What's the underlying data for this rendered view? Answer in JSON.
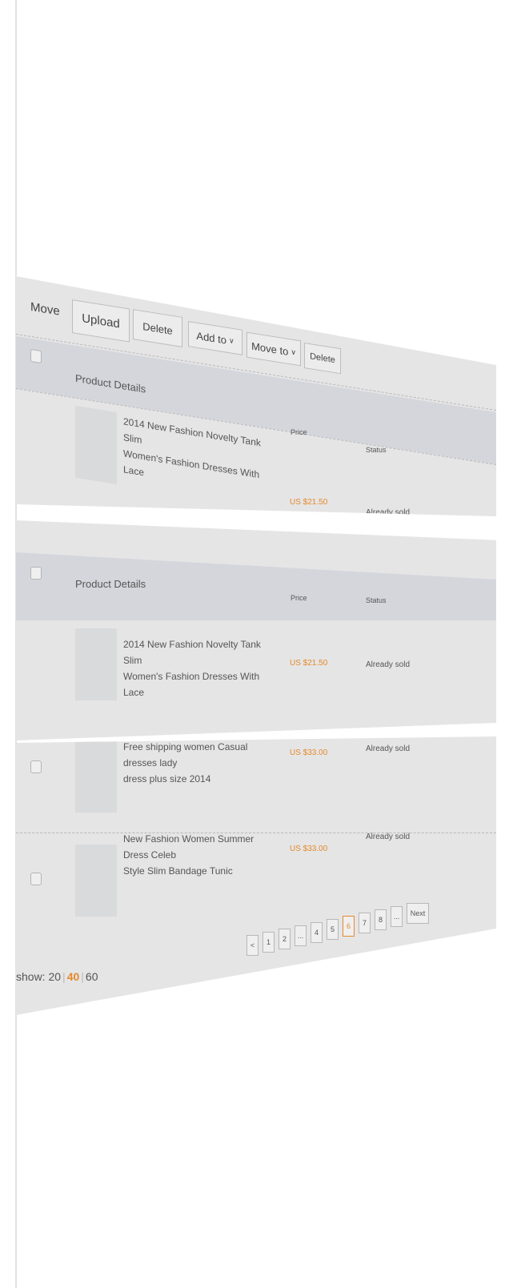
{
  "toolbar": {
    "move": "Move",
    "upload": "Upload",
    "delete": "Delete",
    "add_to": "Add to",
    "move_to": "Move to",
    "delete2": "Delete"
  },
  "table": {
    "header": "Product Details",
    "col_price": "Price",
    "col_status": "Status"
  },
  "products": [
    {
      "title_line1": "2014 New Fashion Novelty Tank Slim",
      "title_line2": "Women's Fashion Dresses With Lace",
      "price": "US $21.50",
      "status": "Already sold"
    },
    {
      "title_line1": "2014 New Fashion Novelty Tank Slim",
      "title_line2": "Women's Fashion Dresses With Lace",
      "price": "US $21.50",
      "status": "Already sold"
    },
    {
      "title_line1": "Free shipping women Casual dresses lady",
      "title_line2": "dress plus size 2014",
      "price": "US $33.00",
      "status": "Already sold"
    },
    {
      "title_line1": "New Fashion Women Summer Dress Celeb",
      "title_line2": "Style Slim Bandage Tunic",
      "price": "US $33.00",
      "status": "Already sold"
    }
  ],
  "pagination": {
    "prev": "<",
    "pages": [
      "1",
      "2",
      "...",
      "4",
      "5",
      "6",
      "7",
      "8",
      "..."
    ],
    "next": "Next",
    "active_page": "6"
  },
  "show": {
    "label": "show:",
    "options": [
      "20",
      "40",
      "60"
    ],
    "selected": "40"
  },
  "colors": {
    "accent": "#e58a2a",
    "sheet": "#e5e5e6",
    "band": "#d4d6dc"
  }
}
